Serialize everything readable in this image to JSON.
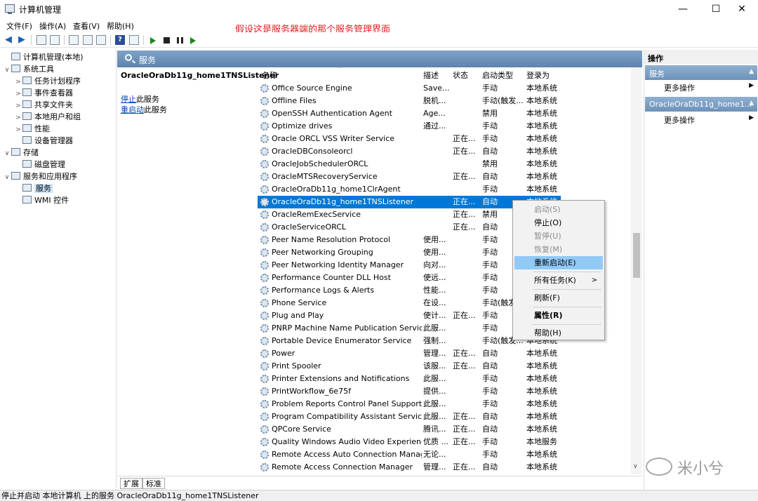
{
  "window": {
    "title": "计算机管理",
    "min_glyph": "—",
    "max_glyph": "☐",
    "close_glyph": "✕"
  },
  "menu": {
    "file": "文件(F)",
    "action": "操作(A)",
    "view": "查看(V)",
    "help": "帮助(H)"
  },
  "annotation": "假设这是服务器端的那个服务管理界面",
  "toolbar": {
    "back_icon": "arrow-left-icon",
    "forward_icon": "arrow-right-icon",
    "help_glyph": "?"
  },
  "tree": [
    {
      "label": "计算机管理(本地)",
      "exp": "",
      "icon": "computer-icon"
    },
    {
      "label": "系统工具",
      "exp": "∨",
      "icon": "tools-icon"
    },
    {
      "label": "任务计划程序",
      "exp": ">",
      "icon": "clock-icon"
    },
    {
      "label": "事件查看器",
      "exp": ">",
      "icon": "event-viewer-icon"
    },
    {
      "label": "共享文件夹",
      "exp": ">",
      "icon": "shared-folder-icon"
    },
    {
      "label": "本地用户和组",
      "exp": ">",
      "icon": "users-icon"
    },
    {
      "label": "性能",
      "exp": ">",
      "icon": "performance-icon"
    },
    {
      "label": "设备管理器",
      "exp": "",
      "icon": "device-manager-icon"
    },
    {
      "label": "存储",
      "exp": "∨",
      "icon": "storage-icon"
    },
    {
      "label": "磁盘管理",
      "exp": "",
      "icon": "disk-icon"
    },
    {
      "label": "服务和应用程序",
      "exp": "∨",
      "icon": "services-apps-icon"
    },
    {
      "label": "服务",
      "exp": "",
      "icon": "services-icon"
    },
    {
      "label": "WMI 控件",
      "exp": "",
      "icon": "wmi-icon"
    }
  ],
  "header": {
    "title": "服务"
  },
  "detail": {
    "service_name": "OracleOraDb11g_home1TNSListener",
    "stop_link": "停止",
    "stop_suffix": "此服务",
    "restart_link": "重启动",
    "restart_suffix": "此服务"
  },
  "columns": {
    "name": "名称",
    "desc": "描述",
    "state": "状态",
    "startup": "启动类型",
    "logon": "登录为",
    "sort_glyph": "^"
  },
  "rows": [
    {
      "name": "Office  Source Engine",
      "desc": "Save...",
      "state": "",
      "startup": "手动",
      "logon": "本地系统"
    },
    {
      "name": "Offline Files",
      "desc": "脱机...",
      "state": "",
      "startup": "手动(触发...",
      "logon": "本地系统"
    },
    {
      "name": "OpenSSH Authentication Agent",
      "desc": "Age...",
      "state": "",
      "startup": "禁用",
      "logon": "本地系统"
    },
    {
      "name": "Optimize drives",
      "desc": "通过...",
      "state": "",
      "startup": "手动",
      "logon": "本地系统"
    },
    {
      "name": "Oracle ORCL VSS Writer Service",
      "desc": "",
      "state": "正在...",
      "startup": "手动",
      "logon": "本地系统"
    },
    {
      "name": "OracleDBConsoleorcl",
      "desc": "",
      "state": "正在...",
      "startup": "自动",
      "logon": "本地系统"
    },
    {
      "name": "OracleJobSchedulerORCL",
      "desc": "",
      "state": "",
      "startup": "禁用",
      "logon": "本地系统"
    },
    {
      "name": "OracleMTSRecoveryService",
      "desc": "",
      "state": "正在...",
      "startup": "自动",
      "logon": "本地系统"
    },
    {
      "name": "OracleOraDb11g_home1ClrAgent",
      "desc": "",
      "state": "",
      "startup": "手动",
      "logon": "本地系统"
    },
    {
      "name": "OracleOraDb11g_home1TNSListener",
      "desc": "",
      "state": "正在...",
      "startup": "自动",
      "logon": "本地系统",
      "selected": true
    },
    {
      "name": "OracleRemExecService",
      "desc": "",
      "state": "正在...",
      "startup": "禁用",
      "logon": "本地系统"
    },
    {
      "name": "OracleServiceORCL",
      "desc": "",
      "state": "正在...",
      "startup": "自动",
      "logon": "本地系统"
    },
    {
      "name": "Peer Name Resolution Protocol",
      "desc": "使用...",
      "state": "",
      "startup": "手动",
      "logon": "本地服务"
    },
    {
      "name": "Peer Networking Grouping",
      "desc": "使用...",
      "state": "",
      "startup": "手动",
      "logon": "本地服务"
    },
    {
      "name": "Peer Networking Identity Manager",
      "desc": "向对...",
      "state": "",
      "startup": "手动",
      "logon": "本地服务"
    },
    {
      "name": "Performance Counter DLL Host",
      "desc": "使远...",
      "state": "",
      "startup": "手动",
      "logon": "本地服务"
    },
    {
      "name": "Performance Logs & Alerts",
      "desc": "性能...",
      "state": "",
      "startup": "手动",
      "logon": "本地服务"
    },
    {
      "name": "Phone Service",
      "desc": "在设...",
      "state": "",
      "startup": "手动(触发...",
      "logon": "本地服务"
    },
    {
      "name": "Plug and Play",
      "desc": "使计...",
      "state": "正在...",
      "startup": "手动",
      "logon": "本地系统"
    },
    {
      "name": "PNRP Machine Name Publication Service",
      "desc": "此服...",
      "state": "",
      "startup": "手动",
      "logon": "本地服务"
    },
    {
      "name": "Portable Device Enumerator Service",
      "desc": "强制...",
      "state": "",
      "startup": "手动(触发...",
      "logon": "本地系统"
    },
    {
      "name": "Power",
      "desc": "管理...",
      "state": "正在...",
      "startup": "自动",
      "logon": "本地系统"
    },
    {
      "name": "Print Spooler",
      "desc": "该服...",
      "state": "正在...",
      "startup": "自动",
      "logon": "本地系统"
    },
    {
      "name": "Printer Extensions and Notifications",
      "desc": "此服...",
      "state": "",
      "startup": "手动",
      "logon": "本地系统"
    },
    {
      "name": "PrintWorkflow_6e75f",
      "desc": "提供...",
      "state": "",
      "startup": "手动",
      "logon": "本地系统"
    },
    {
      "name": "Problem Reports Control Panel Support",
      "desc": "此服...",
      "state": "",
      "startup": "手动",
      "logon": "本地系统"
    },
    {
      "name": "Program Compatibility Assistant Service",
      "desc": "此服...",
      "state": "正在...",
      "startup": "自动",
      "logon": "本地系统"
    },
    {
      "name": "QPCore Service",
      "desc": "腾讯...",
      "state": "正在...",
      "startup": "自动",
      "logon": "本地系统"
    },
    {
      "name": "Quality Windows Audio Video Experience",
      "desc": "优质 ...",
      "state": "正在...",
      "startup": "手动",
      "logon": "本地服务"
    },
    {
      "name": "Remote Access Auto Connection Manag...",
      "desc": "无论...",
      "state": "",
      "startup": "手动",
      "logon": "本地系统"
    },
    {
      "name": "Remote Access Connection Manager",
      "desc": "管理...",
      "state": "正在...",
      "startup": "自动",
      "logon": "本地系统"
    }
  ],
  "context_menu": [
    {
      "label": "启动(S)",
      "disabled": true
    },
    {
      "label": "停止(O)"
    },
    {
      "label": "暂停(U)",
      "disabled": true
    },
    {
      "label": "恢复(M)",
      "disabled": true
    },
    {
      "label": "重新启动(E)",
      "highlighted": true
    },
    {
      "sep": true
    },
    {
      "label": "所有任务(K)",
      "submenu": true
    },
    {
      "sep": true
    },
    {
      "label": "刷新(F)"
    },
    {
      "sep": true
    },
    {
      "label": "属性(R)",
      "bold": true
    },
    {
      "sep": true
    },
    {
      "label": "帮助(H)"
    }
  ],
  "submenu_glyph": ">",
  "tabs": {
    "extended": "扩展",
    "standard": "标准"
  },
  "actions": {
    "title": "操作",
    "group1": "服务",
    "more1": "更多操作",
    "group2": "OracleOraDb11g_home1...",
    "more2": "更多操作",
    "collapse_glyph": "▲",
    "more_glyph": "▶"
  },
  "status": "停止并启动 本地计算机 上的服务 OracleOraDb11g_home1TNSListener",
  "watermark": "米小兮",
  "colors": {
    "selection": "#0078d7",
    "header": "#6b8fb6",
    "annotation": "#e02020",
    "menu_highlight": "#91c9f7"
  }
}
